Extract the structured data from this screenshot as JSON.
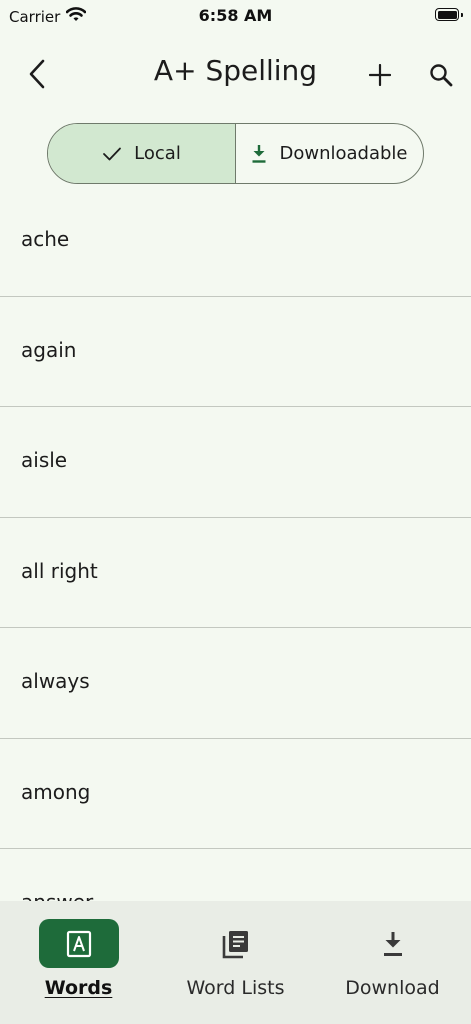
{
  "status_bar": {
    "carrier": "Carrier",
    "time": "6:58 AM"
  },
  "nav": {
    "title": "A+ Spelling"
  },
  "segments": [
    {
      "label": "Local",
      "selected": true,
      "icon": "checkmark-icon"
    },
    {
      "label": "Downloadable",
      "selected": false,
      "icon": "download-icon"
    }
  ],
  "words": [
    "ache",
    "again",
    "aisle",
    "all right",
    "always",
    "among",
    "answer"
  ],
  "tabs": [
    {
      "label": "Words",
      "active": true,
      "icon": "letter-a-icon"
    },
    {
      "label": "Word Lists",
      "active": false,
      "icon": "library-icon"
    },
    {
      "label": "Download",
      "active": false,
      "icon": "download-icon"
    }
  ],
  "colors": {
    "background": "#f4f9f1",
    "accent": "#1e6b3a",
    "selected_segment": "#d2e8d0",
    "tab_bar": "#e9ede6"
  }
}
